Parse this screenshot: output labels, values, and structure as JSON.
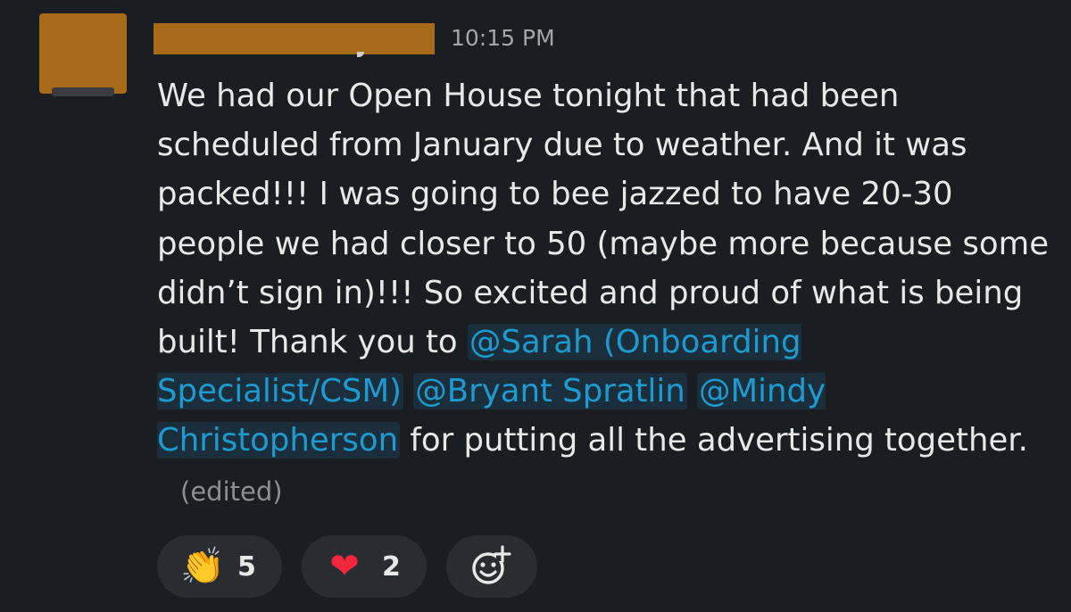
{
  "message": {
    "timestamp": "10:15 PM",
    "body_text": "We had our Open House tonight that had been scheduled from January due to weather. And it was packed!!! I was going to bee jazzed to have 20-30 people we had closer to 50 (maybe more because some didn’t sign in)!!! So excited and proud of what is being built! Thank you to ",
    "mentions": [
      "@Sarah (Onboarding Specialist/CSM)",
      "@Bryant Spratlin",
      "@Mindy Christopherson"
    ],
    "tail_text": " for putting all the advertising together.",
    "edited_label": "(edited)"
  },
  "reactions": [
    {
      "emoji": "👏",
      "icon": "clapping-hands-icon",
      "count": "5"
    },
    {
      "emoji": "❤",
      "icon": "heart-icon",
      "count": "2"
    }
  ],
  "add_reaction": {
    "icon": "add-reaction-icon"
  },
  "colors": {
    "background": "#1a1d21",
    "mention": "#1d9bd1",
    "reaction_bg": "#292c31",
    "redaction": "#a66a19"
  }
}
